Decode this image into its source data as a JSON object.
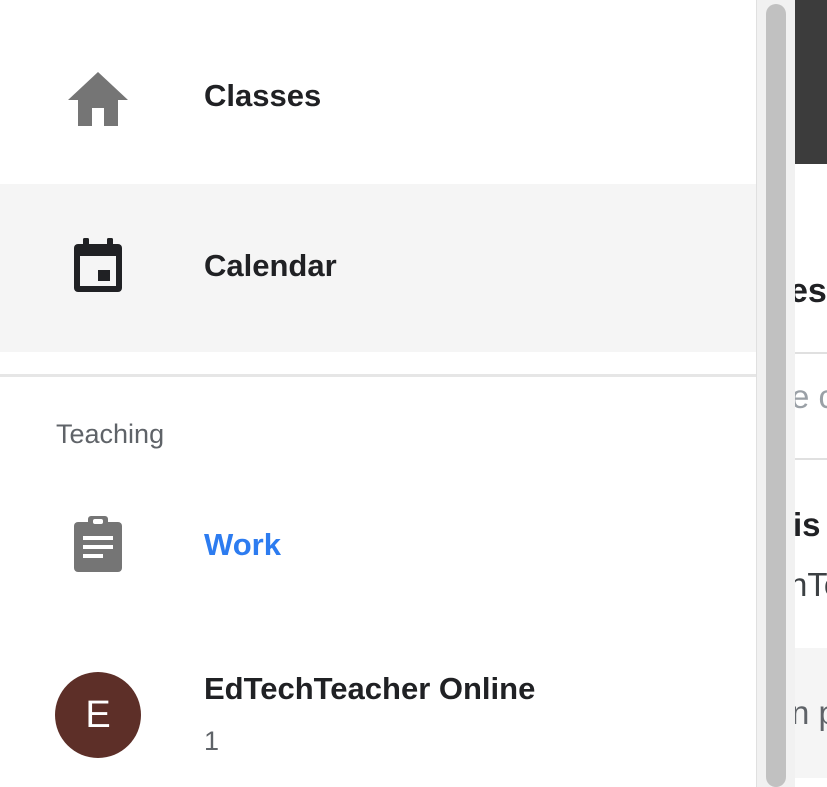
{
  "nav": {
    "classes_label": "Classes",
    "classes_icon": "home-icon",
    "calendar_label": "Calendar",
    "calendar_icon": "calendar-icon"
  },
  "teaching": {
    "header": "Teaching",
    "work_label": "Work",
    "work_icon": "assignment-icon",
    "class": {
      "avatar_letter": "E",
      "name": "EdTechTeacher Online",
      "count": "1"
    }
  },
  "background_peek": {
    "text1": "es",
    "text2": "e c",
    "text3": "is",
    "text4": "nTe",
    "text5": "n p"
  },
  "colors": {
    "accent": "#2d7cf0",
    "avatar": "#5d2f28",
    "selected_bg": "#f5f5f5",
    "icon": "#757575"
  }
}
